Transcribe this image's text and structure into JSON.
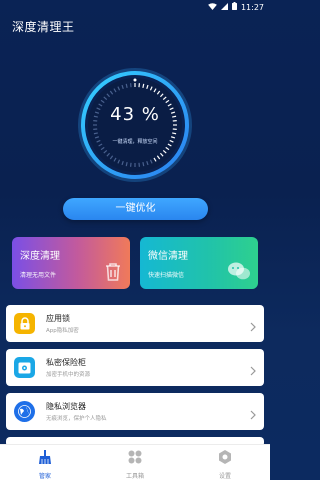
{
  "status_bar": {
    "time": "11:27"
  },
  "app_title": "深度清理王",
  "gauge": {
    "percent": "43 %",
    "subtitle": "一键清理，释放空间",
    "progress": 0.43
  },
  "optimize_button": "一键优化",
  "cards": [
    {
      "title": "深度清理",
      "subtitle": "清理无用文件"
    },
    {
      "title": "微信清理",
      "subtitle": "快速扫描微信"
    }
  ],
  "list": [
    {
      "title": "应用锁",
      "subtitle": "App隐私加密",
      "icon": "lock-icon",
      "color": "#f5b400"
    },
    {
      "title": "私密保险柜",
      "subtitle": "加密手机中的资源",
      "icon": "safe-box-icon",
      "color": "#1aa7e6"
    },
    {
      "title": "隐私浏览器",
      "subtitle": "无痕浏览，保护个人隐私",
      "icon": "globe-icon",
      "color": "#1e6fe8"
    }
  ],
  "bottom_nav": [
    {
      "label": "管家",
      "icon": "broom-icon",
      "active": true
    },
    {
      "label": "工具箱",
      "icon": "grid-icon",
      "active": false
    },
    {
      "label": "设置",
      "icon": "gear-icon",
      "active": false
    }
  ],
  "colors": {
    "accent": "#2a86ef",
    "background": "#0a2355",
    "nav_active": "#1f5fd6"
  }
}
